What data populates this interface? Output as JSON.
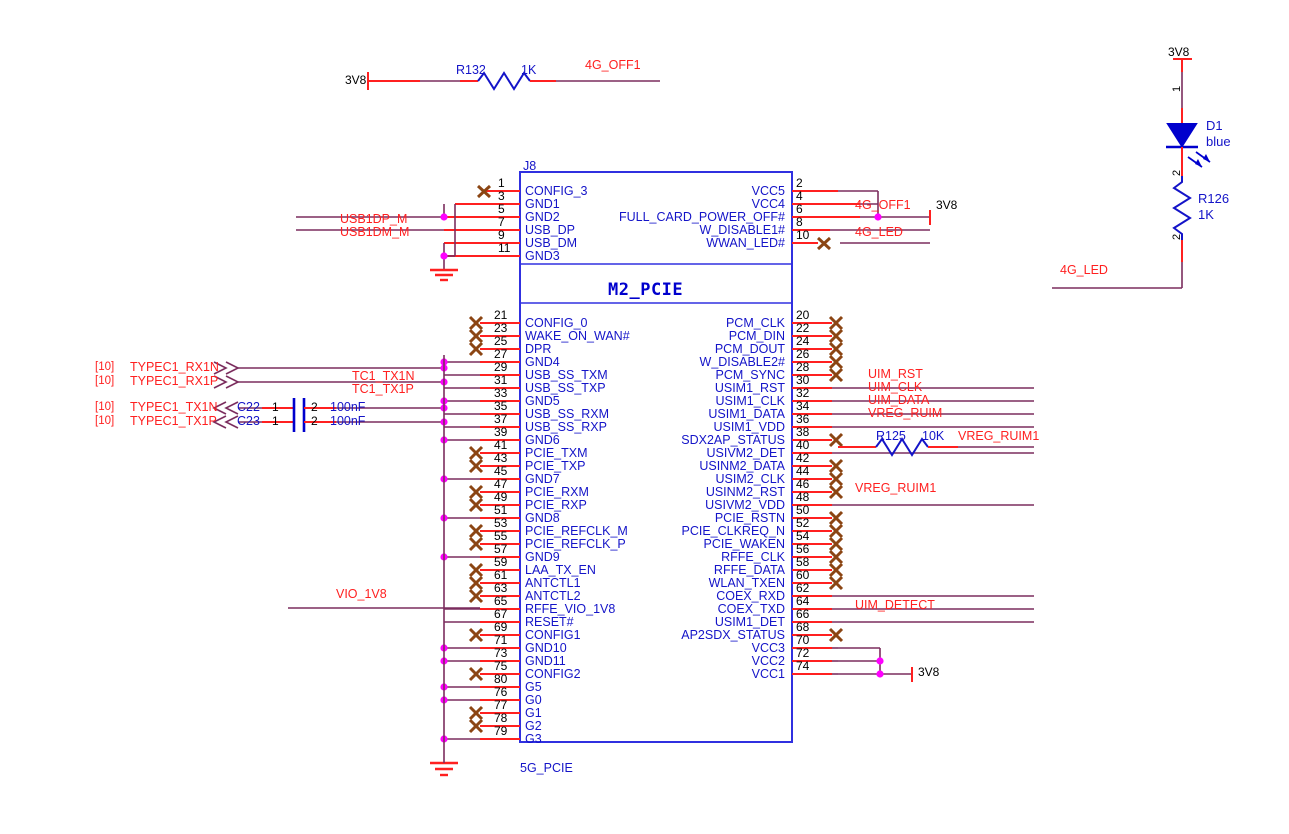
{
  "sheet": {
    "designator_top": "J8",
    "component_title": "M2_PCIE",
    "bottom_caption": "5G_PCIE"
  },
  "colors": {
    "net": "#ff2020",
    "wire": "#7b2d5e",
    "pin_wire": "#ff2020",
    "symbol": "#0000cd",
    "junction": "#ff00ff",
    "nc_cross": "#8b4513",
    "ground": "#ff2020",
    "text_pin": "#1414c8",
    "text_num": "#000000"
  },
  "top_left_circuit": {
    "power_label": "3V8",
    "resistor_ref": "R132",
    "resistor_value": "1K",
    "out_net": "4G_OFF1"
  },
  "right_led_circuit": {
    "power_label": "3V8",
    "diode_ref": "D1",
    "diode_value": "blue",
    "diode_pin1": "1",
    "diode_pin2": "2",
    "resistor_ref": "R126",
    "resistor_value": "1K",
    "resistor_pin1": "1",
    "resistor_pin2": "2",
    "out_net": "4G_LED"
  },
  "left_nets": {
    "usb_dp": "USB1DP_M",
    "usb_dm": "USB1DM_M",
    "vio": "VIO_1V8",
    "offsheet_tag": "[10]",
    "ports": [
      {
        "tag": "[10]",
        "name": "TYPEC1_RX1N"
      },
      {
        "tag": "[10]",
        "name": "TYPEC1_RX1P"
      },
      {
        "tag": "[10]",
        "name": "TYPEC1_TX1N"
      },
      {
        "tag": "[10]",
        "name": "TYPEC1_TX1P"
      }
    ],
    "caps": [
      {
        "ref": "C22",
        "pin1": "1",
        "pin2": "2",
        "value": "100nF",
        "out_net": "TC1_TX1N"
      },
      {
        "ref": "C23",
        "pin1": "1",
        "pin2": "2",
        "value": "100nF",
        "out_net": "TC1_TX1P"
      }
    ]
  },
  "right_nets": {
    "g4_off1": "4G_OFF1",
    "power_top": "3V8",
    "g4_led": "4G_LED",
    "uim_rst": "UIM_RST",
    "uim_clk": "UIM_CLK",
    "uim_data": "UIM_DATA",
    "vreg_ruim": "VREG_RUIM",
    "vreg_ruim1_a": "VREG_RUIM1",
    "vreg_ruim1_b": "VREG_RUIM1",
    "uim_detect": "UIM_DETECT",
    "power_bottom": "3V8",
    "resistor_ref": "R125",
    "resistor_value": "10K"
  },
  "connector": {
    "top_left_pins": [
      {
        "num": "1",
        "name": "CONFIG_3",
        "nc": true
      },
      {
        "num": "3",
        "name": "GND1",
        "nc": false
      },
      {
        "num": "5",
        "name": "GND2",
        "nc": false
      },
      {
        "num": "7",
        "name": "USB_DP",
        "nc": false
      },
      {
        "num": "9",
        "name": "USB_DM",
        "nc": false
      },
      {
        "num": "11",
        "name": "GND3",
        "nc": false
      }
    ],
    "top_right_pins": [
      {
        "num": "2",
        "name": "VCC5",
        "nc": false
      },
      {
        "num": "4",
        "name": "VCC4",
        "nc": false
      },
      {
        "num": "6",
        "name": "FULL_CARD_POWER_OFF#",
        "nc": false
      },
      {
        "num": "8",
        "name": "W_DISABLE1#",
        "nc": false
      },
      {
        "num": "10",
        "name": "WWAN_LED#",
        "nc": true
      }
    ],
    "left_pins": [
      {
        "num": "21",
        "name": "CONFIG_0",
        "nc": true
      },
      {
        "num": "23",
        "name": "WAKE_ON_WAN#",
        "nc": true
      },
      {
        "num": "25",
        "name": "DPR",
        "nc": true
      },
      {
        "num": "27",
        "name": "GND4",
        "nc": false
      },
      {
        "num": "29",
        "name": "USB_SS_TXM",
        "nc": false
      },
      {
        "num": "31",
        "name": "USB_SS_TXP",
        "nc": false
      },
      {
        "num": "33",
        "name": "GND5",
        "nc": false
      },
      {
        "num": "35",
        "name": "USB_SS_RXM",
        "nc": false
      },
      {
        "num": "37",
        "name": "USB_SS_RXP",
        "nc": false
      },
      {
        "num": "39",
        "name": "GND6",
        "nc": false
      },
      {
        "num": "41",
        "name": "PCIE_TXM",
        "nc": true
      },
      {
        "num": "43",
        "name": "PCIE_TXP",
        "nc": true
      },
      {
        "num": "45",
        "name": "GND7",
        "nc": false
      },
      {
        "num": "47",
        "name": "PCIE_RXM",
        "nc": true
      },
      {
        "num": "49",
        "name": "PCIE_RXP",
        "nc": true
      },
      {
        "num": "51",
        "name": "GND8",
        "nc": false
      },
      {
        "num": "53",
        "name": "PCIE_REFCLK_M",
        "nc": true
      },
      {
        "num": "55",
        "name": "PCIE_REFCLK_P",
        "nc": true
      },
      {
        "num": "57",
        "name": "GND9",
        "nc": false
      },
      {
        "num": "59",
        "name": "LAA_TX_EN",
        "nc": true
      },
      {
        "num": "61",
        "name": "ANTCTL1",
        "nc": true
      },
      {
        "num": "63",
        "name": "ANTCTL2",
        "nc": true
      },
      {
        "num": "65",
        "name": "RFFE_VIO_1V8",
        "nc": false
      },
      {
        "num": "67",
        "name": "RESET#",
        "nc": false
      },
      {
        "num": "69",
        "name": "CONFIG1",
        "nc": true
      },
      {
        "num": "71",
        "name": "GND10",
        "nc": false
      },
      {
        "num": "73",
        "name": "GND11",
        "nc": false
      },
      {
        "num": "75",
        "name": "CONFIG2",
        "nc": true
      },
      {
        "num": "80",
        "name": "G5",
        "nc": false
      },
      {
        "num": "76",
        "name": "G0",
        "nc": false
      },
      {
        "num": "77",
        "name": "G1",
        "nc": true
      },
      {
        "num": "78",
        "name": "G2",
        "nc": true
      },
      {
        "num": "79",
        "name": "G3",
        "nc": false
      }
    ],
    "right_pins": [
      {
        "num": "20",
        "name": "PCM_CLK",
        "nc": true
      },
      {
        "num": "22",
        "name": "PCM_DIN",
        "nc": true
      },
      {
        "num": "24",
        "name": "PCM_DOUT",
        "nc": true
      },
      {
        "num": "26",
        "name": "W_DISABLE2#",
        "nc": true
      },
      {
        "num": "28",
        "name": "PCM_SYNC",
        "nc": true
      },
      {
        "num": "30",
        "name": "USIM1_RST",
        "nc": false
      },
      {
        "num": "32",
        "name": "USIM1_CLK",
        "nc": false
      },
      {
        "num": "34",
        "name": "USIM1_DATA",
        "nc": false
      },
      {
        "num": "36",
        "name": "USIM1_VDD",
        "nc": false
      },
      {
        "num": "38",
        "name": "SDX2AP_STATUS",
        "nc": true
      },
      {
        "num": "40",
        "name": "USIVM2_DET",
        "nc": false
      },
      {
        "num": "42",
        "name": "USINM2_DATA",
        "nc": true
      },
      {
        "num": "44",
        "name": "USIM2_CLK",
        "nc": true
      },
      {
        "num": "46",
        "name": "USINM2_RST",
        "nc": true
      },
      {
        "num": "48",
        "name": "USIVM2_VDD",
        "nc": false
      },
      {
        "num": "50",
        "name": "PCIE_RSTN",
        "nc": true
      },
      {
        "num": "52",
        "name": "PCIE_CLKREQ_N",
        "nc": true
      },
      {
        "num": "54",
        "name": "PCIE_WAKEN",
        "nc": true
      },
      {
        "num": "56",
        "name": "RFFE_CLK",
        "nc": true
      },
      {
        "num": "58",
        "name": "RFFE_DATA",
        "nc": true
      },
      {
        "num": "60",
        "name": "WLAN_TXEN",
        "nc": true
      },
      {
        "num": "62",
        "name": "COEX_RXD",
        "nc": false
      },
      {
        "num": "64",
        "name": "COEX_TXD",
        "nc": false
      },
      {
        "num": "66",
        "name": "USIM1_DET",
        "nc": false
      },
      {
        "num": "68",
        "name": "AP2SDX_STATUS",
        "nc": true
      },
      {
        "num": "70",
        "name": "VCC3",
        "nc": false
      },
      {
        "num": "72",
        "name": "VCC2",
        "nc": false
      },
      {
        "num": "74",
        "name": "VCC1",
        "nc": false
      }
    ]
  }
}
